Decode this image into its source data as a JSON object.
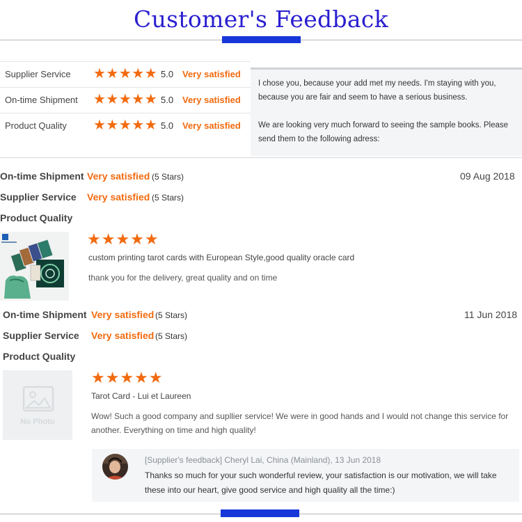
{
  "header": {
    "title": "Customer's Feedback"
  },
  "summary": {
    "rows": [
      {
        "label": "Supplier Service",
        "score": "5.0",
        "satisfaction": "Very satisfied",
        "stars": 5
      },
      {
        "label": "On-time Shipment",
        "score": "5.0",
        "satisfaction": "Very satisfied",
        "stars": 5
      },
      {
        "label": "Product Quality",
        "score": "5.0",
        "satisfaction": "Very satisfied",
        "stars": 5
      }
    ],
    "message": {
      "para1": "I chose you, because your add met my needs. I'm staying with you, because you are fair and seem to have a serious business.",
      "para2": "We are looking very much forward to seeing the sample books. Please send them to the following adress:"
    }
  },
  "reviews": [
    {
      "date": "09 Aug 2018",
      "ratings": [
        {
          "label": "On-time Shipment",
          "satisfaction": "Very satisfied",
          "stars_note": "(5 Stars)"
        },
        {
          "label": "Supplier Service",
          "satisfaction": "Very satisfied",
          "stars_note": "(5 Stars)"
        },
        {
          "label": "Product Quality",
          "satisfaction": "",
          "stars_note": ""
        }
      ],
      "stars": 5,
      "product": "custom printing tarot cards with European Style,good quality oracle card",
      "comment": "thank you for the delivery, great quality and on time"
    },
    {
      "date": "11 Jun 2018",
      "ratings": [
        {
          "label": "On-time Shipment",
          "satisfaction": "Very satisfied",
          "stars_note": "(5 Stars)"
        },
        {
          "label": "Supplier Service",
          "satisfaction": "Very satisfied",
          "stars_note": "(5 Stars)"
        },
        {
          "label": "Product Quality",
          "satisfaction": "",
          "stars_note": ""
        }
      ],
      "stars": 5,
      "product": "Tarot Card - Lui et Laureen",
      "comment": "Wow! Such a good company and supllier service! We were in good hands and I would not change this service for another. Everything on time and high quality!",
      "no_photo_text": "No Photo",
      "supplier_reply": {
        "meta": "[Supplier's feedback] Cheryl Lai, China (Mainland), 13 Jun 2018",
        "text": "Thanks so much for your such wonderful review, your satisfaction is our motivation, we will take these into our heart, give good service and high quality all the time:)"
      }
    }
  ],
  "icons": {
    "star": "star-icon",
    "avatar": "avatar",
    "no_photo": "no-photo-icon"
  },
  "colors": {
    "title": "#2a1fd0",
    "accent_orange": "#f26a0f",
    "blue_bar": "#1737d8",
    "panel_bg": "#f4f5f7"
  }
}
